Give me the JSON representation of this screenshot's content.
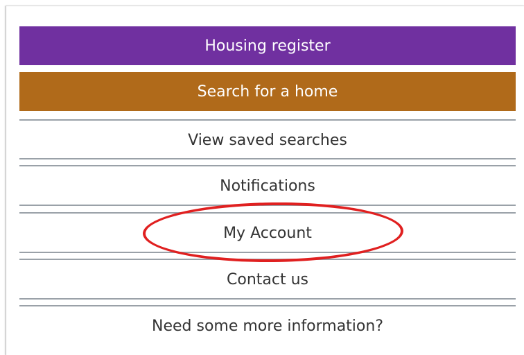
{
  "menu": {
    "items": [
      {
        "label": "Housing register",
        "style": "primary"
      },
      {
        "label": "Search for a home",
        "style": "secondary"
      },
      {
        "label": "View saved searches",
        "style": "plain"
      },
      {
        "label": "Notifications",
        "style": "plain"
      },
      {
        "label": "My Account",
        "style": "plain",
        "highlighted": true
      },
      {
        "label": "Contact us",
        "style": "plain"
      },
      {
        "label": "Need some more information?",
        "style": "plain"
      }
    ]
  },
  "colors": {
    "primary": "#7030a0",
    "secondary": "#b06a1a",
    "separator": "#9aa1a8",
    "highlight": "#e02020",
    "text": "#333333"
  }
}
